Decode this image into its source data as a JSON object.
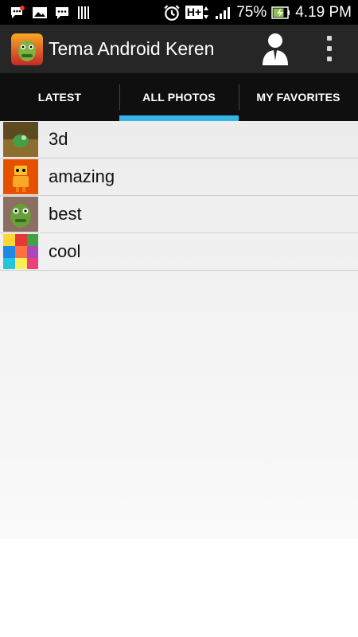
{
  "status_bar": {
    "battery": "75%",
    "time": "4.19 PM",
    "network": "H+"
  },
  "app_bar": {
    "title": "Tema Android Keren",
    "icons": [
      "app-logo-icon",
      "person-icon",
      "overflow-menu-icon"
    ]
  },
  "tabs": [
    {
      "label": "LATEST",
      "selected": false
    },
    {
      "label": "ALL PHOTOS",
      "selected": true
    },
    {
      "label": "MY FAVORITES",
      "selected": false
    }
  ],
  "list": [
    {
      "label": "3d"
    },
    {
      "label": "amazing"
    },
    {
      "label": "best"
    },
    {
      "label": "cool"
    }
  ],
  "colors": {
    "accent": "#33b5e5",
    "action_bar": "#262626",
    "tab_bar": "#0f0f0f"
  }
}
